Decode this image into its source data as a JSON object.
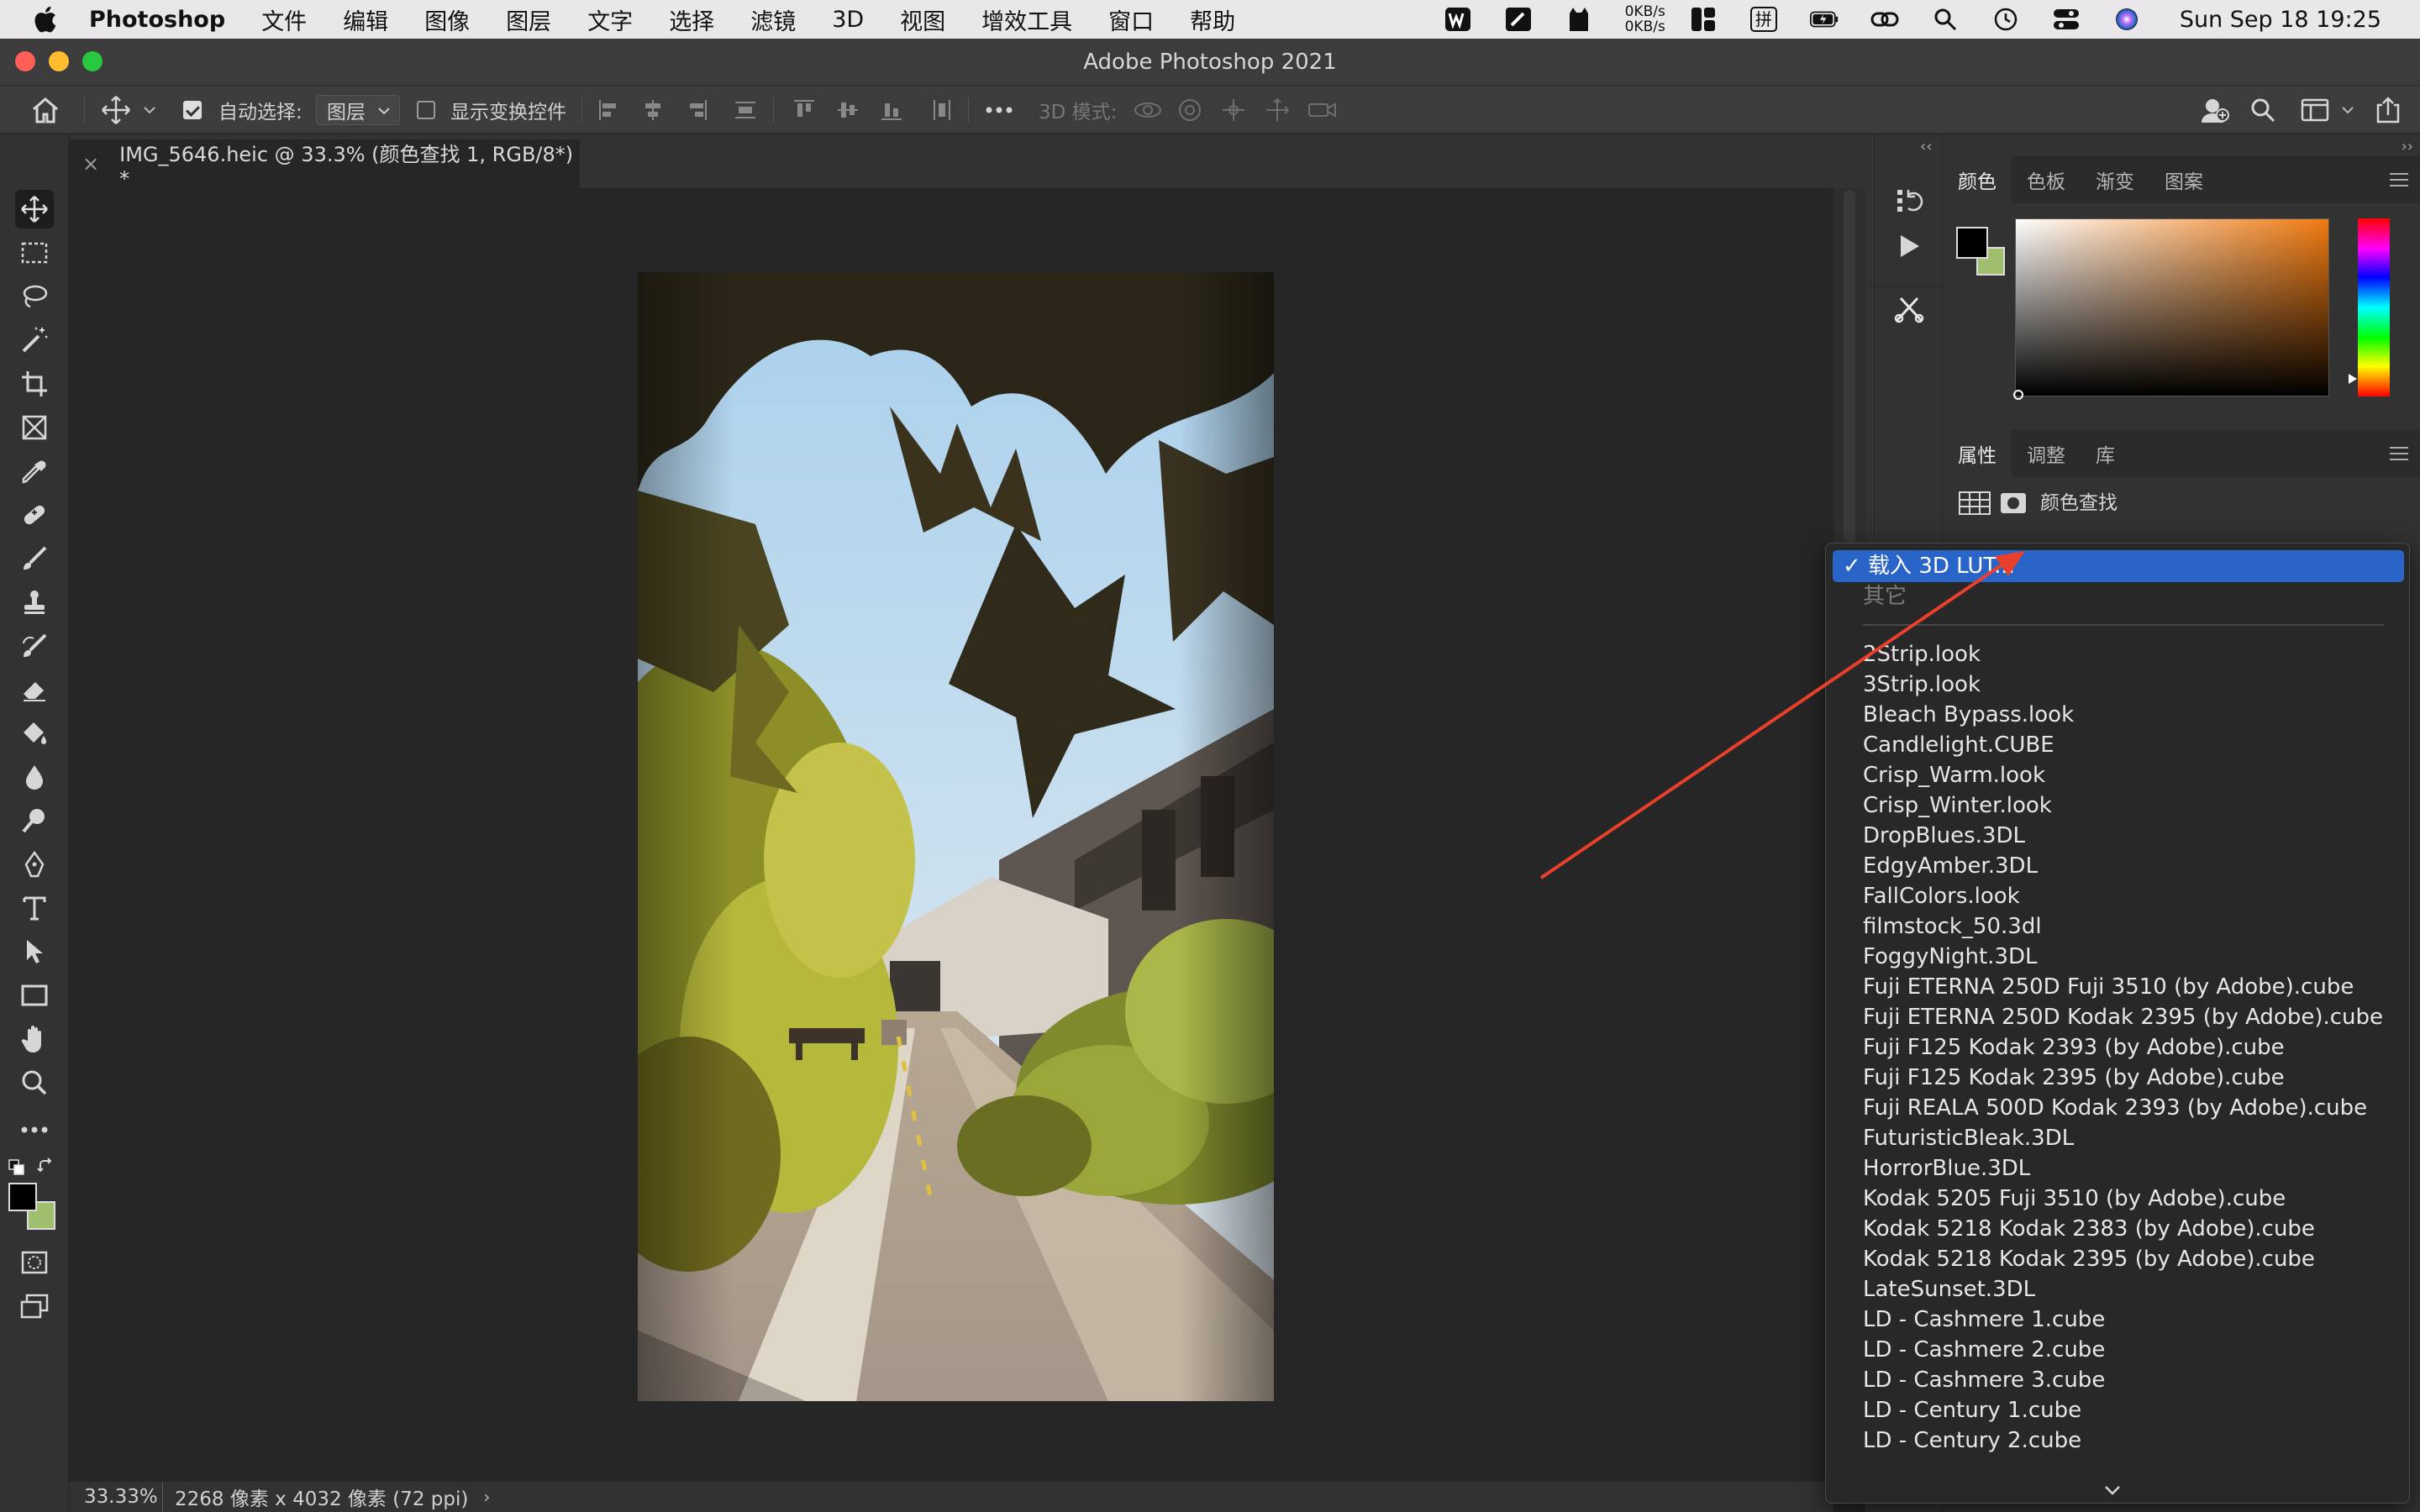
{
  "menubar": {
    "app_name": "Photoshop",
    "items": [
      "文件",
      "编辑",
      "图像",
      "图层",
      "文字",
      "选择",
      "滤镜",
      "3D",
      "视图",
      "增效工具",
      "窗口",
      "帮助"
    ],
    "net_up": "0KB/s",
    "net_down": "0KB/s",
    "ime": "拼",
    "clock": "Sun Sep 18  19:25"
  },
  "window": {
    "title": "Adobe Photoshop 2021"
  },
  "options_bar": {
    "auto_select_label": "自动选择:",
    "auto_select_checked": true,
    "layer_select_value": "图层",
    "show_transform_label": "显示变换控件",
    "show_transform_checked": false,
    "mode_3d_label": "3D 模式:"
  },
  "document": {
    "tab_title": "IMG_5646.heic @ 33.3% (颜色查找 1, RGB/8*) *",
    "zoom": "33.33%",
    "dimensions": "2268 像素 x 4032 像素 (72 ppi)"
  },
  "color_panel": {
    "tabs": [
      "颜色",
      "色板",
      "渐变",
      "图案"
    ],
    "active_tab": "颜色",
    "foreground_color": "#000000",
    "background_color": "#9fbe6e",
    "hue_color": "#f07a10"
  },
  "properties_panel": {
    "tabs": [
      "属性",
      "调整",
      "库"
    ],
    "active_tab": "属性",
    "adjustment_name": "颜色查找"
  },
  "lut_dropdown": {
    "selected": "✓ 载入 3D LUT...",
    "disabled_label": "其它",
    "items": [
      "2Strip.look",
      "3Strip.look",
      "Bleach Bypass.look",
      "Candlelight.CUBE",
      "Crisp_Warm.look",
      "Crisp_Winter.look",
      "DropBlues.3DL",
      "EdgyAmber.3DL",
      "FallColors.look",
      "filmstock_50.3dl",
      "FoggyNight.3DL",
      "Fuji ETERNA 250D Fuji 3510 (by Adobe).cube",
      "Fuji ETERNA 250D Kodak 2395 (by Adobe).cube",
      "Fuji F125 Kodak 2393 (by Adobe).cube",
      "Fuji F125 Kodak 2395 (by Adobe).cube",
      "Fuji REALA 500D Kodak 2393 (by Adobe).cube",
      "FuturisticBleak.3DL",
      "HorrorBlue.3DL",
      "Kodak 5205 Fuji 3510 (by Adobe).cube",
      "Kodak 5218 Kodak 2383 (by Adobe).cube",
      "Kodak 5218 Kodak 2395 (by Adobe).cube",
      "LateSunset.3DL",
      "LD - Cashmere 1.cube",
      "LD - Cashmere 2.cube",
      "LD - Cashmere 3.cube",
      "LD - Century 1.cube",
      "LD - Century 2.cube"
    ]
  },
  "annotation": {
    "arrow_color": "#e8402a"
  }
}
